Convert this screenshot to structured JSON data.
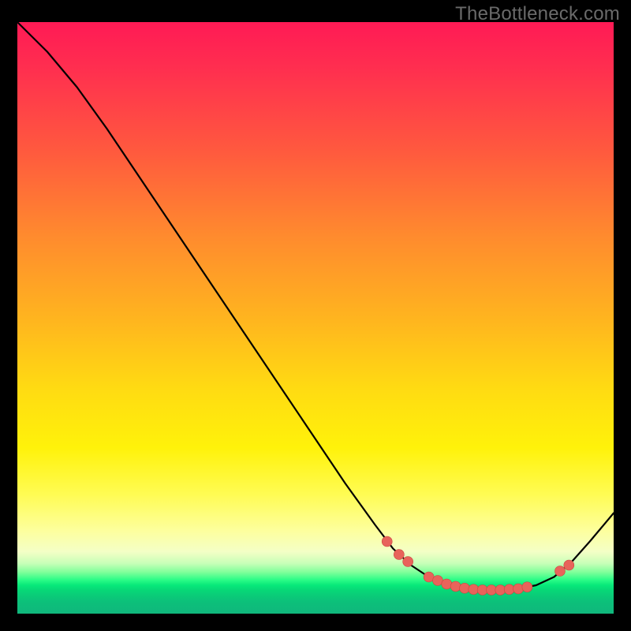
{
  "watermark": "TheBottleneck.com",
  "chart_data": {
    "type": "line",
    "title": "",
    "xlabel": "",
    "ylabel": "",
    "xlim": [
      0,
      100
    ],
    "ylim": [
      0,
      100
    ],
    "grid": false,
    "legend": false,
    "background": "heatmap-gradient",
    "gradient_stops": [
      {
        "pos": 0,
        "color": "#ff1a55"
      },
      {
        "pos": 22,
        "color": "#ff5a3e"
      },
      {
        "pos": 50,
        "color": "#ffb41f"
      },
      {
        "pos": 72,
        "color": "#fff20a"
      },
      {
        "pos": 88,
        "color": "#f4ffc6"
      },
      {
        "pos": 94,
        "color": "#2bfc86"
      },
      {
        "pos": 100,
        "color": "#10b77c"
      }
    ],
    "series": [
      {
        "name": "bottleneck-curve",
        "x": [
          0,
          5,
          10,
          15,
          20,
          25,
          30,
          35,
          40,
          45,
          50,
          55,
          60,
          63,
          66,
          69,
          72,
          75,
          78,
          81,
          84,
          87,
          90,
          93,
          96,
          100
        ],
        "y": [
          100,
          95,
          89,
          82,
          74.5,
          67,
          59.5,
          52,
          44.5,
          37,
          29.5,
          22,
          15,
          11,
          8.2,
          6.2,
          5.0,
          4.3,
          4.0,
          4.0,
          4.2,
          4.8,
          6.2,
          8.8,
          12.2,
          17
        ]
      }
    ],
    "markers": {
      "name": "highlight-points",
      "color": "#e8635b",
      "x": [
        62,
        64,
        65.5,
        69,
        70.5,
        72,
        73.5,
        75,
        76.5,
        78,
        79.5,
        81,
        82.5,
        84,
        85.5,
        91,
        92.5
      ],
      "y": [
        12.2,
        10.0,
        8.8,
        6.2,
        5.6,
        5.0,
        4.6,
        4.3,
        4.1,
        4.0,
        4.0,
        4.0,
        4.1,
        4.2,
        4.5,
        7.2,
        8.2
      ]
    }
  }
}
